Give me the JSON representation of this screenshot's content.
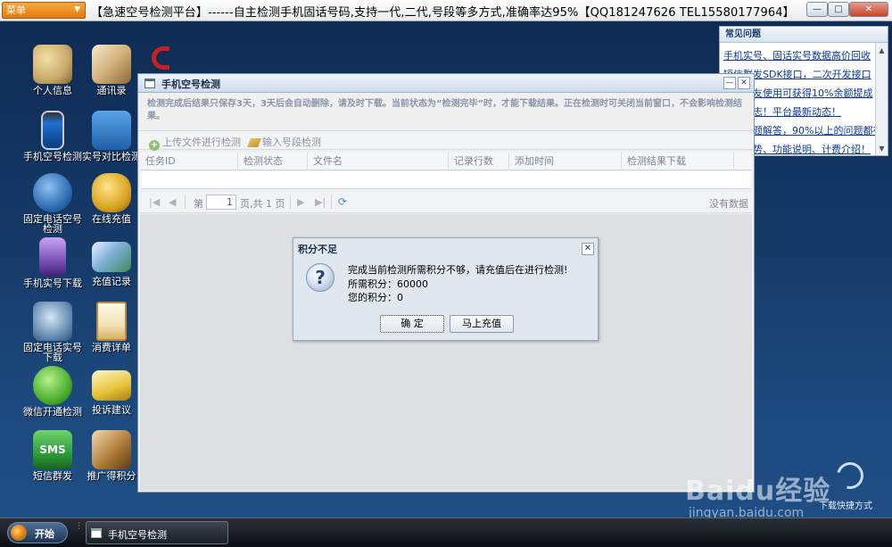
{
  "titlebar": {
    "menu_label": "菜单",
    "app_title": "【急速空号检测平台】------自主检测手机固话号码,支持一代,二代,号段等多方式,准确率达95%【QQ181247626  TEL15580177964】"
  },
  "desktop": [
    {
      "label": "个人信息",
      "icon": "keys-icon",
      "color": "#c9a96a"
    },
    {
      "label": "通讯录",
      "icon": "address-book-icon",
      "color": "#8b6a3d"
    },
    {
      "label": "手机空号检测",
      "icon": "mobile-phone-icon",
      "color": "#1f6fd1"
    },
    {
      "label": "实号对比检测",
      "icon": "magnifier-icon",
      "color": "#2a78c8"
    },
    {
      "label": "固定电话空号检测",
      "icon": "desk-phone-icon",
      "color": "#2f6db3"
    },
    {
      "label": "在线充值",
      "icon": "coins-icon",
      "color": "#d9a521"
    },
    {
      "label": "手机实号下载",
      "icon": "cell-phone-download-icon",
      "color": "#7a4fb8"
    },
    {
      "label": "充值记录",
      "icon": "credit-card-icon",
      "color": "#3a8a56"
    },
    {
      "label": "固定电话实号下载",
      "icon": "telephone-icon",
      "color": "#5f88ad"
    },
    {
      "label": "消费详单",
      "icon": "clipboard-icon",
      "color": "#d7b163"
    },
    {
      "label": "微信开通检测",
      "icon": "wechat-icon",
      "color": "#4caf2d"
    },
    {
      "label": "投诉建议",
      "icon": "envelope-icon",
      "color": "#e6c237"
    },
    {
      "label": "短信群发",
      "icon": "sms-icon",
      "color": "#2e9b3a"
    },
    {
      "label": "推广得积分",
      "icon": "promotion-book-icon",
      "color": "#b07d3a"
    }
  ],
  "faq": {
    "title": "常见问题",
    "items": [
      "手机实号、固话实号数据高价回收",
      "短信群发SDK接口，二次开发接口",
      "推荐好友使用可获得10%余额提成",
      "更新日志！平台最新动态！",
      "常见问题解答，90%以上的问题都有",
      "平台优势、功能说明、计费介绍！"
    ]
  },
  "main_window": {
    "title": "手机空号检测",
    "notice": "检测完成后结果只保存3天，3天后会自动删除，请及时下载。当前状态为“检测完毕”时，才能下载结果。正在检测时可关闭当前窗口，不会影响检测结果。",
    "toolbar": {
      "upload_label": "上传文件进行检测",
      "input_label": "输入号段检测"
    },
    "columns": [
      "任务ID",
      "检测状态",
      "文件名",
      "记录行数",
      "添加时间",
      "检测结果下载"
    ],
    "pager": {
      "page_prefix": "第",
      "page_value": "1",
      "page_suffix": "页,共 1 页",
      "empty_text": "没有数据"
    }
  },
  "modal": {
    "title": "积分不足",
    "message": "完成当前检测所需积分不够，请充值后在进行检测!",
    "required_line": "所需积分：60000",
    "balance_line": "您的积分：0",
    "ok_label": "确  定",
    "recharge_label": "马上充值"
  },
  "taskbar": {
    "start_label": "开始",
    "task_label": "手机空号检测"
  },
  "watermark": {
    "brand": "Baidu经验",
    "url": "jingyan.baidu.com",
    "shortcut": "下载快捷方式"
  }
}
